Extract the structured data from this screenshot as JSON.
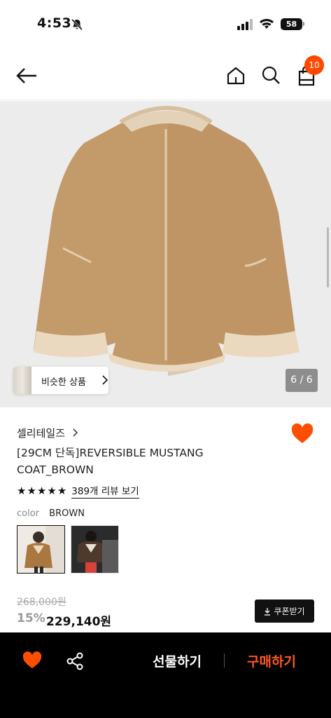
{
  "status_bar": {
    "time": "4:53",
    "battery": "58"
  },
  "header": {
    "cart_count": "10"
  },
  "gallery": {
    "similar_label": "비슷한 상품",
    "page_counter": "6 / 6"
  },
  "product": {
    "brand": "셀리테일즈",
    "title": "[29CM 단독]REVERSIBLE MUSTANG COAT_BROWN",
    "rating_stars": 5,
    "review_link": "389개 리뷰 보기",
    "color_label": "color",
    "color_value": "BROWN",
    "original_price": "268,000원",
    "discount": "15%",
    "sale_price": "229,140원",
    "coupon_label": "쿠폰받기",
    "liked": true
  },
  "bottom_bar": {
    "gift_label": "선물하기",
    "buy_label": "구매하기"
  },
  "colors": {
    "accent": "#ff4800",
    "heart": "#ff4e00",
    "buy": "#ff5a1f"
  },
  "icons": [
    "bell-slash-icon",
    "signal-icon",
    "wifi-icon",
    "back-arrow-icon",
    "home-icon",
    "search-icon",
    "cart-icon",
    "heart-icon",
    "share-icon",
    "download-icon",
    "chevron-right-icon",
    "star-icon"
  ]
}
